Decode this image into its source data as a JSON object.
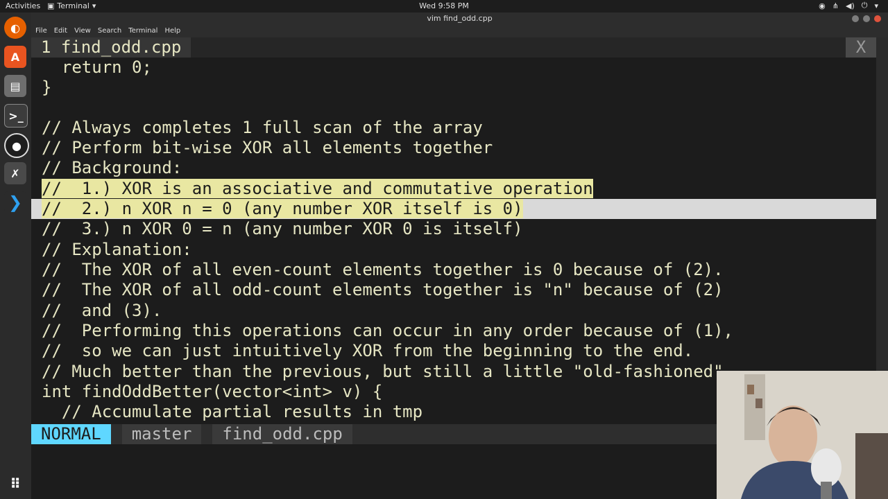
{
  "topbar": {
    "activities": "Activities",
    "app": "Terminal",
    "clock": "Wed  9:58 PM"
  },
  "window": {
    "title": "vim find_odd.cpp",
    "menu": [
      "File",
      "Edit",
      "View",
      "Search",
      "Terminal",
      "Help"
    ]
  },
  "vim": {
    "tab_label": "1  find_odd.cpp",
    "close_label": "X",
    "lines": [
      "  return 0;",
      "}",
      "",
      "// Always completes 1 full scan of the array",
      "// Perform bit-wise XOR all elements together",
      "// Background:",
      "//  1.) XOR is an associative and commutative operation",
      "//  2.) n XOR n = 0 (any number XOR itself is 0)",
      "//  3.) n XOR 0 = n (any number XOR 0 is itself)",
      "// Explanation:",
      "//  The XOR of all even-count elements together is 0 because of (2).",
      "//  The XOR of all odd-count elements together is \"n\" because of (2)",
      "//  and (3).",
      "//  Performing this operations can occur in any order because of (1),",
      "//  so we can just intuitively XOR from the beginning to the end.",
      "// Much better than the previous, but still a little \"old-fashioned\"",
      "int findOddBetter(vector<int> v) {",
      "  // Accumulate partial results in tmp"
    ],
    "status": {
      "mode": "NORMAL",
      "branch": "master",
      "file": "find_odd.cpp"
    }
  }
}
